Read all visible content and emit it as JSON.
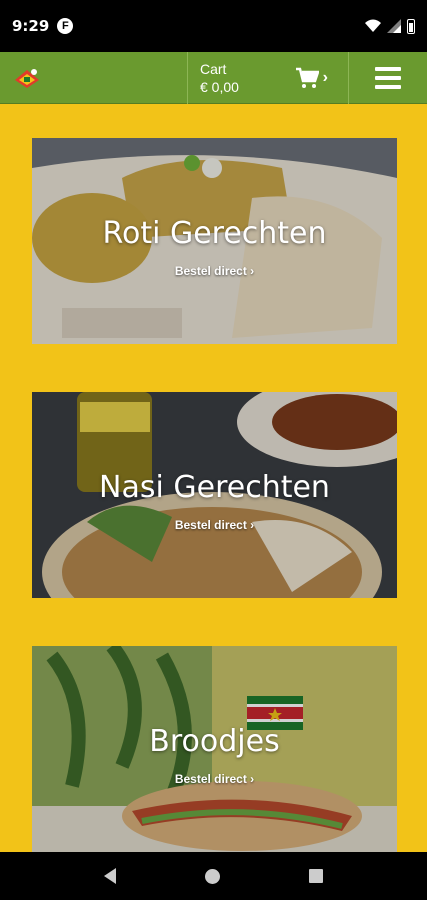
{
  "status": {
    "time": "9:29",
    "notif_icon": "F"
  },
  "header": {
    "logo": "logo-icon",
    "cart_label": "Cart",
    "cart_total": "€ 0,00",
    "cart_chevron": "›",
    "menu": "hamburger-menu-icon",
    "brand_color": "#6a9a2f"
  },
  "background_color": "#f2c318",
  "categories": [
    {
      "title": "Roti Gerechten",
      "link": "Bestel direct ›"
    },
    {
      "title": "Nasi Gerechten",
      "link": "Bestel direct ›"
    },
    {
      "title": "Broodjes",
      "link": "Bestel direct ›"
    }
  ]
}
